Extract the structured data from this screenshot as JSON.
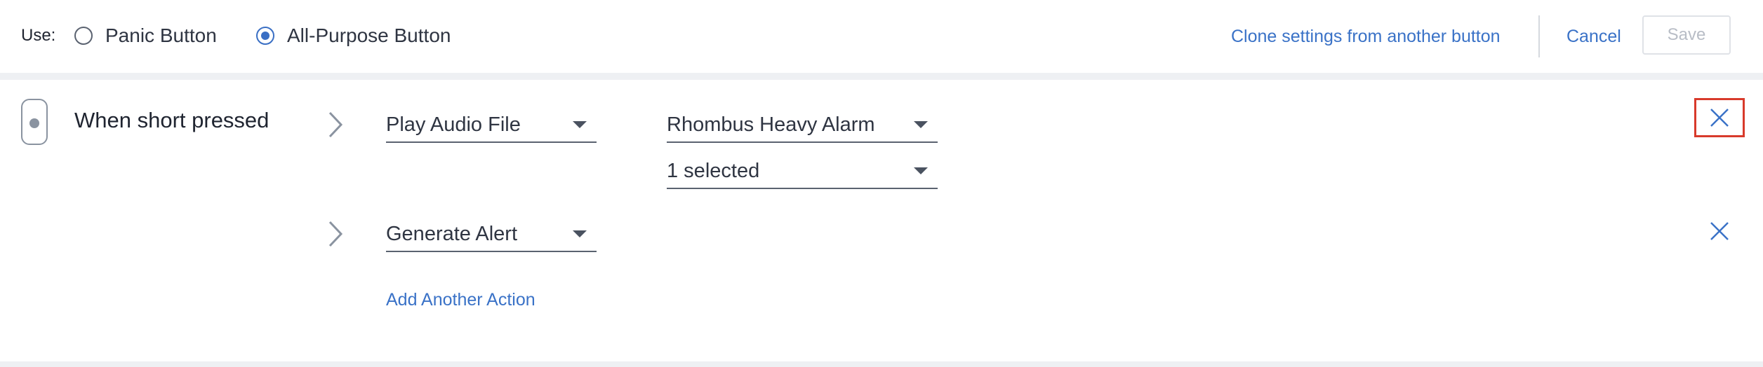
{
  "header": {
    "use_label": "Use:",
    "mode_options": [
      {
        "label": "Panic Button",
        "selected": false
      },
      {
        "label": "All-Purpose Button",
        "selected": true
      }
    ],
    "clone_label": "Clone settings from another button",
    "cancel_label": "Cancel",
    "save_label": "Save",
    "save_enabled": false
  },
  "trigger": {
    "icon": "button-device-icon",
    "label": "When short pressed"
  },
  "actions": [
    {
      "type": "Play Audio File",
      "params": [
        "Rhombus Heavy Alarm",
        "1 selected"
      ],
      "remove_highlighted": true
    },
    {
      "type": "Generate Alert",
      "params": [],
      "remove_highlighted": false
    }
  ],
  "add_action_label": "Add Another Action",
  "colors": {
    "accent": "#3a72c7",
    "highlight_border": "#d83a2b",
    "page_background": "#eef0f3"
  }
}
